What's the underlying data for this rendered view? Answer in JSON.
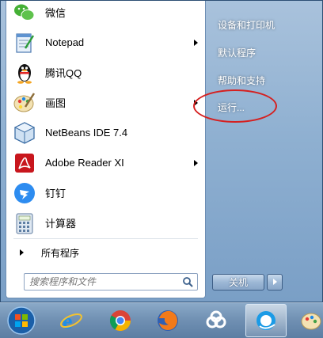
{
  "start_menu": {
    "programs": [
      {
        "label": "微信",
        "icon": "wechat-icon",
        "has_submenu": false
      },
      {
        "label": "Notepad",
        "icon": "notepad-icon",
        "has_submenu": true
      },
      {
        "label": "腾讯QQ",
        "icon": "qq-penguin-icon",
        "has_submenu": false
      },
      {
        "label": "画图",
        "icon": "paint-palette-icon",
        "has_submenu": true
      },
      {
        "label": "NetBeans IDE 7.4",
        "icon": "netbeans-cube-icon",
        "has_submenu": false
      },
      {
        "label": "Adobe Reader XI",
        "icon": "adobe-reader-icon",
        "has_submenu": true
      },
      {
        "label": "钉钉",
        "icon": "dingtalk-icon",
        "has_submenu": false
      },
      {
        "label": "计算器",
        "icon": "calculator-icon",
        "has_submenu": false
      }
    ],
    "all_programs_label": "所有程序",
    "search": {
      "placeholder": "搜索程序和文件"
    },
    "right_items": [
      {
        "label": "设备和打印机"
      },
      {
        "label": "默认程序"
      },
      {
        "label": "帮助和支持"
      },
      {
        "label": "运行..."
      }
    ],
    "shutdown_label": "关机",
    "highlight_color": "#d52020"
  },
  "taskbar": {
    "items": [
      "start-orb-icon",
      "internet-explorer-icon",
      "chrome-icon",
      "firefox-icon",
      "baidu-netdisk-icon",
      "qq-browser-icon",
      "paint-icon"
    ]
  }
}
